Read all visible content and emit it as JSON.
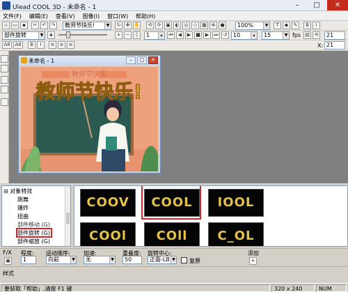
{
  "window": {
    "title": "Ulead COOL 3D - 未命名 - 1",
    "minimize": "–",
    "maximize": "□",
    "close": "✕"
  },
  "menu": [
    "文件(F)",
    "编辑(E)",
    "查看(V)",
    "图像(I)",
    "窗口(W)",
    "帮助(H)"
  ],
  "toolbar1": {
    "text_combo": "教师节快乐!",
    "zoom_combo": "100%"
  },
  "toolbar2": {
    "object_combo": "部件旋转",
    "frame_value": "1",
    "frame_total": "10",
    "fps_value": "15",
    "fps_label": "fps",
    "frame_end": "21"
  },
  "toolbar3": {
    "font_label_a": "A8",
    "font_label_b": "A8",
    "x_label": "X:",
    "x_value": "21"
  },
  "child_window": {
    "title": "未命名 - 1",
    "scene_text": "教师节快乐!",
    "scene_text_top": "教师节快乐"
  },
  "tree": {
    "root": "对象特效",
    "items": [
      "跳舞",
      "爆炸",
      "扭曲",
      "部件移动 (G)",
      "部件旋转 (G)",
      "部件缩放 (G)"
    ]
  },
  "gallery": {
    "thumbnails": [
      "COOV",
      "COOL",
      "IOOL",
      "COOl",
      "COll",
      "C_OL"
    ],
    "selected_index": 1
  },
  "props": {
    "col1_label": "F/X",
    "degree_label": "程度:",
    "degree_value": "1",
    "motion_order_label": "运动顺序:",
    "motion_order_value": "向前",
    "accel_label": "加速:",
    "accel_value": "无",
    "overlap_label": "重叠度:",
    "overlap_value": "50",
    "rotation_center_label": "旋转中心:",
    "rotation_center_value": "正面-LB",
    "restore_label": "复原",
    "add_label": "添加"
  },
  "stylebar": {
    "label": "样式"
  },
  "status": {
    "help_text": "要获取「帮助」,请按 F1 键",
    "dimensions": "320 x 240",
    "numlock": "NUM"
  }
}
